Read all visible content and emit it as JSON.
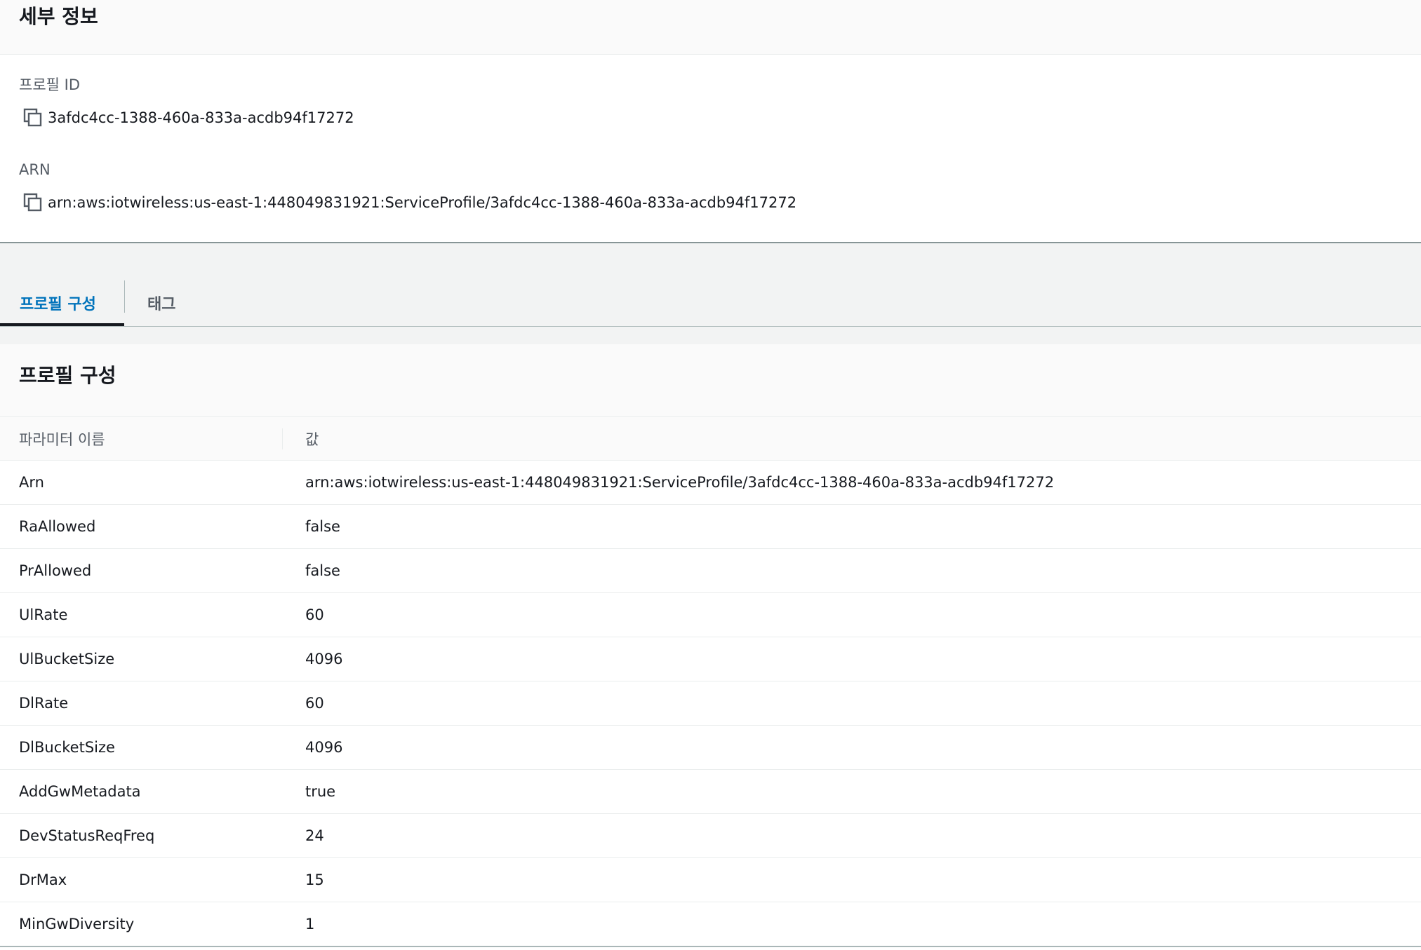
{
  "details": {
    "title": "세부 정보",
    "profile_id_label": "프로필 ID",
    "profile_id_value": "3afdc4cc-1388-460a-833a-acdb94f17272",
    "arn_label": "ARN",
    "arn_value": "arn:aws:iotwireless:us-east-1:448049831921:ServiceProfile/3afdc4cc-1388-460a-833a-acdb94f17272"
  },
  "tabs": [
    {
      "label": "프로필 구성",
      "active": true
    },
    {
      "label": "태그",
      "active": false
    }
  ],
  "config": {
    "title": "프로필 구성",
    "columns": [
      "파라미터 이름",
      "값"
    ],
    "rows": [
      {
        "name": "Arn",
        "value": "arn:aws:iotwireless:us-east-1:448049831921:ServiceProfile/3afdc4cc-1388-460a-833a-acdb94f17272"
      },
      {
        "name": "RaAllowed",
        "value": "false"
      },
      {
        "name": "PrAllowed",
        "value": "false"
      },
      {
        "name": "UlRate",
        "value": "60"
      },
      {
        "name": "UlBucketSize",
        "value": "4096"
      },
      {
        "name": "DlRate",
        "value": "60"
      },
      {
        "name": "DlBucketSize",
        "value": "4096"
      },
      {
        "name": "AddGwMetadata",
        "value": "true"
      },
      {
        "name": "DevStatusReqFreq",
        "value": "24"
      },
      {
        "name": "DrMax",
        "value": "15"
      },
      {
        "name": "MinGwDiversity",
        "value": "1"
      }
    ]
  },
  "icons": {
    "copy": "copy-icon"
  }
}
